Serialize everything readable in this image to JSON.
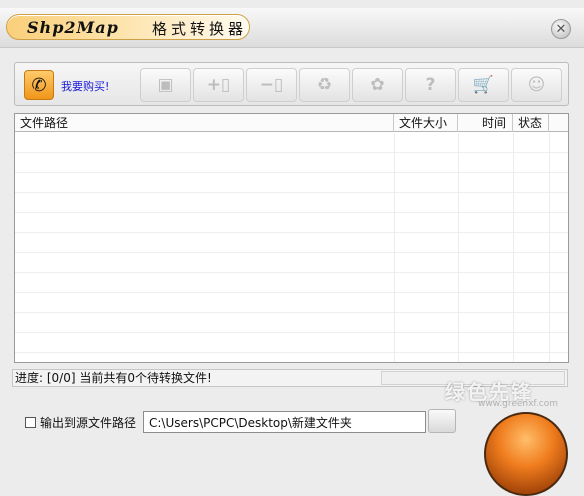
{
  "window": {
    "title_brand": "Shp2Map",
    "title_rest": "格式转换器"
  },
  "toolbar": {
    "buy_label": "我要购买!",
    "buttons": [
      {
        "name": "open-folder-icon",
        "glyph": "▣"
      },
      {
        "name": "add-file-icon",
        "glyph": "+▯"
      },
      {
        "name": "remove-file-icon",
        "glyph": "−▯"
      },
      {
        "name": "clear-list-icon",
        "glyph": "♻"
      },
      {
        "name": "settings-icon",
        "glyph": "✿"
      },
      {
        "name": "help-icon",
        "glyph": "?"
      },
      {
        "name": "cart-icon",
        "glyph": "🛒"
      },
      {
        "name": "support-icon",
        "glyph": "☺"
      }
    ]
  },
  "table": {
    "columns": [
      "文件路径",
      "文件大小",
      "时间",
      "状态"
    ],
    "rows": []
  },
  "status": {
    "text": "进度: [0/0] 当前共有0个待转换文件!"
  },
  "output": {
    "checkbox_label": "输出到源文件路径",
    "checked": false,
    "path_value": "C:\\Users\\PCPC\\Desktop\\新建文件夹"
  },
  "watermark": {
    "text": "绿色先锋",
    "subtext": "www.greenxf.com"
  }
}
